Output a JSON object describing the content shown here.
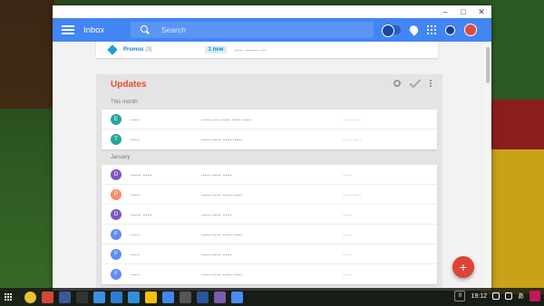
{
  "window": {
    "controls": [
      "–",
      "□",
      "✕"
    ]
  },
  "appbar": {
    "title": "Inbox",
    "search_placeholder": "Search"
  },
  "promo": {
    "label": "Promos",
    "count": "(3)",
    "badge": "1 new",
    "preview": "...... ......... ...."
  },
  "updates": {
    "title": "Updates",
    "sections": [
      {
        "label": "This month",
        "emails": [
          {
            "initial": "E",
            "color": "#26a69a",
            "sender": "......",
            "subject": "...... ..... ...... ...... ......",
            "snippet": "..... ......"
          },
          {
            "initial": "T",
            "color": "#26a69a",
            "sender": "......",
            "subject": "...... ...... ...... ......",
            "snippet": "...... ....."
          }
        ]
      },
      {
        "label": "January",
        "emails": [
          {
            "initial": "D",
            "color": "#7e57c2",
            "sender": "....... ......",
            "subject": "...... ...... ......",
            "snippet": "......"
          },
          {
            "initial": "P",
            "color": "#ff8a65",
            "sender": "......",
            "subject": "...... ...... ...... ......",
            "snippet": "...... ....."
          },
          {
            "initial": "D",
            "color": "#7e57c2",
            "sender": "....... ......",
            "subject": "...... ...... ......",
            "snippet": "......"
          },
          {
            "initial": "F",
            "color": "#5c8df6",
            "sender": "......",
            "subject": "...... ...... ...... ......",
            "snippet": "......"
          },
          {
            "initial": "F",
            "color": "#5c8df6",
            "sender": "......",
            "subject": "...... ...... ......",
            "snippet": "......"
          },
          {
            "initial": "F",
            "color": "#5c8df6",
            "sender": "......",
            "subject": "...... ...... ...... ......",
            "snippet": "......"
          }
        ]
      }
    ]
  },
  "fab": {
    "label": "+"
  },
  "shelf": {
    "apps": [
      {
        "name": "chrome",
        "color": "#e8c32e"
      },
      {
        "name": "gmail",
        "color": "#d44638"
      },
      {
        "name": "facebook",
        "color": "#3b5998"
      },
      {
        "name": "camera",
        "color": "#333333"
      },
      {
        "name": "cloud",
        "color": "#3d8ee6"
      },
      {
        "name": "dropbox",
        "color": "#2a7fd4"
      },
      {
        "name": "files",
        "color": "#2f8fd9"
      },
      {
        "name": "keep",
        "color": "#f4c20d"
      },
      {
        "name": "calendar",
        "color": "#4285f4"
      },
      {
        "name": "drive-folder",
        "color": "#555555"
      },
      {
        "name": "word",
        "color": "#2b579a"
      },
      {
        "name": "note",
        "color": "#7b5bb0"
      },
      {
        "name": "inbox",
        "color": "#4a8ef5"
      }
    ],
    "notification_count": "0",
    "time": "19:12",
    "ime": "あ"
  }
}
